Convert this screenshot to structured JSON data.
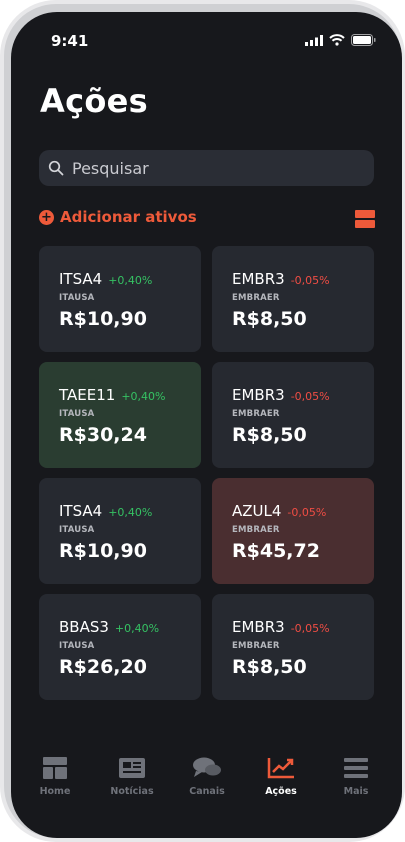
{
  "status": {
    "time": "9:41"
  },
  "page_title": "Ações",
  "search": {
    "placeholder": "Pesquisar"
  },
  "add_assets_label": "Adicionar ativos",
  "cards": [
    {
      "ticker": "ITSA4",
      "change": "+0,40%",
      "direction": "up",
      "company": "ITAUSA",
      "price": "R$10,90",
      "highlight": "none"
    },
    {
      "ticker": "EMBR3",
      "change": "-0,05%",
      "direction": "down",
      "company": "EMBRAER",
      "price": "R$8,50",
      "highlight": "none"
    },
    {
      "ticker": "TAEE11",
      "change": "+0,40%",
      "direction": "up",
      "company": "ITAUSA",
      "price": "R$30,24",
      "highlight": "green"
    },
    {
      "ticker": "EMBR3",
      "change": "-0,05%",
      "direction": "down",
      "company": "EMBRAER",
      "price": "R$8,50",
      "highlight": "none"
    },
    {
      "ticker": "ITSA4",
      "change": "+0,40%",
      "direction": "up",
      "company": "ITAUSA",
      "price": "R$10,90",
      "highlight": "none"
    },
    {
      "ticker": "AZUL4",
      "change": "-0,05%",
      "direction": "down",
      "company": "EMBRAER",
      "price": "R$45,72",
      "highlight": "red"
    },
    {
      "ticker": "BBAS3",
      "change": "+0,40%",
      "direction": "up",
      "company": "ITAUSA",
      "price": "R$26,20",
      "highlight": "none"
    },
    {
      "ticker": "EMBR3",
      "change": "-0,05%",
      "direction": "down",
      "company": "EMBRAER",
      "price": "R$8,50",
      "highlight": "none"
    }
  ],
  "tabs": [
    {
      "label": "Home",
      "icon": "home-icon",
      "active": false
    },
    {
      "label": "Notícias",
      "icon": "newspaper-icon",
      "active": false
    },
    {
      "label": "Canais",
      "icon": "chat-icon",
      "active": false
    },
    {
      "label": "Ações",
      "icon": "chart-icon",
      "active": true
    },
    {
      "label": "Mais",
      "icon": "menu-icon",
      "active": false
    }
  ],
  "colors": {
    "accent": "#ee5a3a",
    "positive": "#35c163",
    "negative": "#ef4d44",
    "background": "#17181c",
    "card": "#262930"
  }
}
